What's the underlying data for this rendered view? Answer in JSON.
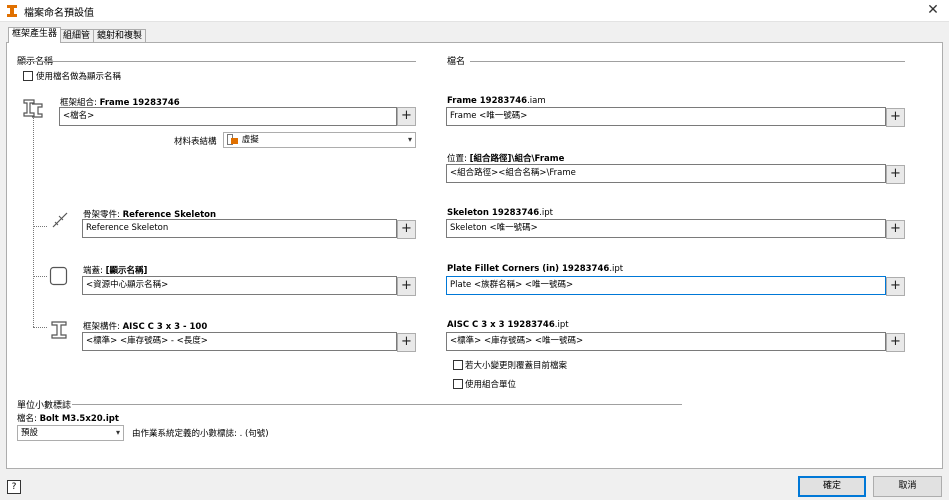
{
  "window": {
    "title": "檔案命名預設值"
  },
  "tabs": [
    {
      "label": "框架產生器"
    },
    {
      "label": "組細管"
    },
    {
      "label": "鏡射和複製"
    }
  ],
  "display_name": {
    "header": "顯示名稱",
    "use_filename_label": "使用檔名做為顯示名稱"
  },
  "filename": {
    "header": "檔名"
  },
  "rows": {
    "frame_assembly": {
      "label_prefix": "框架組合:",
      "label_bold": "Frame 19283746",
      "value": "<檔名>"
    },
    "bom_structure": {
      "label": "材料表結構",
      "value": "虛擬"
    },
    "frame_file": {
      "label_bold": "Frame 19283746",
      "label_suffix": ".iam",
      "value": "Frame <唯一號碼>"
    },
    "location": {
      "label_prefix": "位置:",
      "label_bold": "[組合路徑]\\組合\\Frame",
      "value": "<組合路徑><組合名稱>\\Frame"
    },
    "skeleton_part": {
      "label_prefix": "骨架零件:",
      "label_bold": "Reference Skeleton",
      "value": "Reference Skeleton"
    },
    "skeleton_file": {
      "label_bold": "Skeleton 19283746",
      "label_suffix": ".ipt",
      "value": "Skeleton <唯一號碼>"
    },
    "end_cap": {
      "label_prefix": "端蓋:",
      "label_bold": "[顯示名稱]",
      "value": "<資源中心顯示名稱>"
    },
    "end_cap_file": {
      "label_bold": "Plate Fillet Corners (in) 19283746",
      "label_suffix": ".ipt",
      "value": "Plate <族群名稱> <唯一號碼>"
    },
    "frame_member": {
      "label_prefix": "框架構件:",
      "label_bold": "AISC C 3 x 3 - 100",
      "value": "<標準> <庫存號碼> - <長度>"
    },
    "member_file": {
      "label_bold": "AISC C 3 x 3 19283746",
      "label_suffix": ".ipt",
      "value": "<標準> <庫存號碼> <唯一號碼>"
    }
  },
  "options": {
    "overwrite_label": "若大小變更則覆蓋目前檔案",
    "use_assembly_units_label": "使用組合單位"
  },
  "decimal": {
    "header": "單位小數標誌",
    "filename_prefix": "檔名:",
    "filename_bold": "Bolt M3.5x20.ipt",
    "select_value": "預設",
    "description": "由作業系統定義的小數標誌: . (句號)"
  },
  "buttons": {
    "ok": "確定",
    "cancel": "取消",
    "help": "?",
    "plus": "+"
  },
  "colors": {
    "focus": "#0078d7",
    "accent_icon": "#e07000"
  }
}
